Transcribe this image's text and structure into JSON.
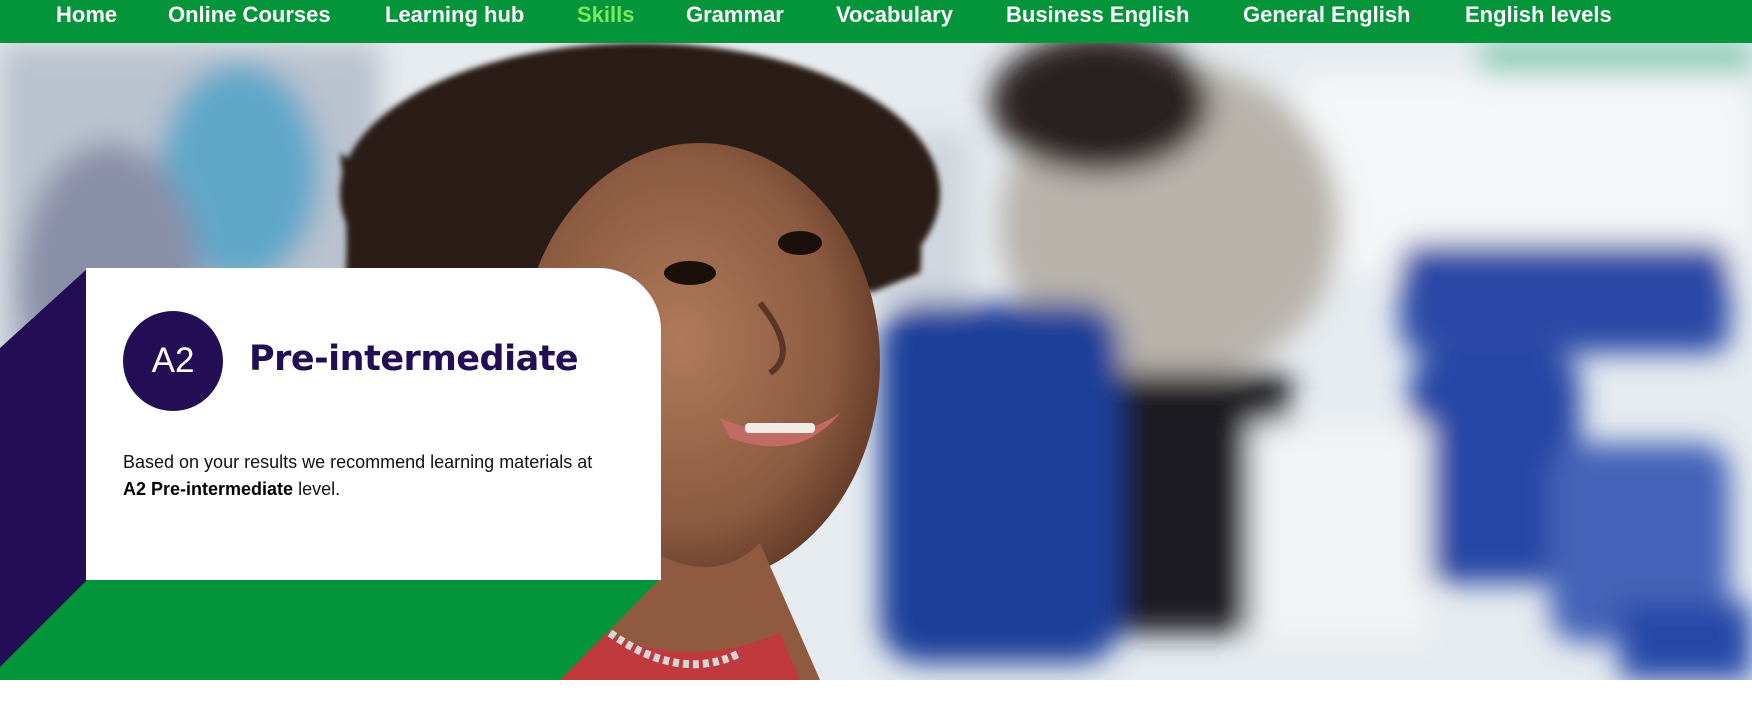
{
  "nav": {
    "items": [
      {
        "label": "Home",
        "active": false
      },
      {
        "label": "Online Courses",
        "active": false
      },
      {
        "label": "Learning hub",
        "active": false
      },
      {
        "label": "Skills",
        "active": true
      },
      {
        "label": "Grammar",
        "active": false
      },
      {
        "label": "Vocabulary",
        "active": false
      },
      {
        "label": "Business English",
        "active": false
      },
      {
        "label": "General English",
        "active": false
      },
      {
        "label": "English levels",
        "active": false
      }
    ]
  },
  "result": {
    "badge": "A2",
    "title": "Pre-intermediate",
    "desc_prefix": "Based on your results we recommend learning materials at ",
    "desc_bold": "A2 Pre-intermediate",
    "desc_suffix": " level."
  },
  "colors": {
    "nav_bg": "#04953a",
    "nav_active": "#7be860",
    "brand_purple": "#230d55",
    "brand_green": "#04953a"
  }
}
